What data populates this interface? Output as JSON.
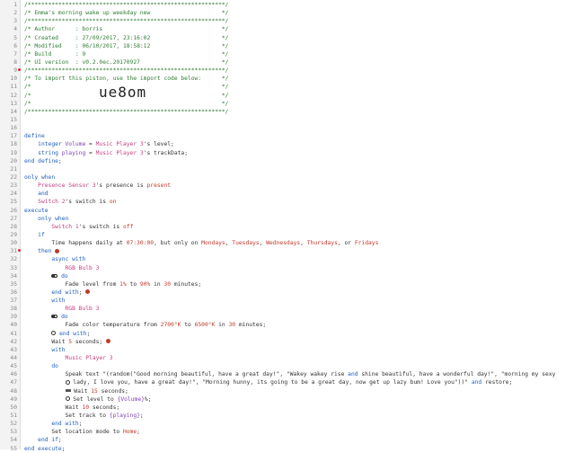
{
  "editor": {
    "lines": [
      "/**********************************************************/",
      "/* Emma's morning wake up weekday new                     */",
      "/**********************************************************/",
      "/* Author      : borris                                   */",
      "/* Created     : 27/09/2017, 23:16:02                     */",
      "/* Modified    : 06/10/2017, 18:58:12                     */",
      "/* Build       : 9                                        */",
      "/* UI version  : v0.2.0ec.20170927                        */",
      "/**********************************************************/",
      "/* To import this piston, use the import code below:      */",
      "/*                                                        */",
      "/*                                                        */",
      "/*                                                        */",
      "/**********************************************************/",
      "",
      "",
      "define",
      "    integer Volume = Music Player 3's level;",
      "    string playing = Music Player 3's trackData;",
      "end define;",
      "",
      "only when",
      "    Presence Sensor 3's presence is present",
      "    and",
      "    Switch 2's switch is on",
      "execute",
      "    only when",
      "        Switch 1's switch is off",
      "    if",
      "        Time happens daily at 07:30:00, but only on Mondays, Tuesdays, Wednesdays, Thursdays, or Fridays",
      "    then",
      "        async with",
      "            RGB Bulb 3",
      "        do",
      "            Fade level from 1% to 90% in 30 minutes;",
      "        end with;",
      "        with",
      "            RGB Bulb 3",
      "        do",
      "            Fade color temperature from 2700°K to 6500°K in 30 minutes;",
      "        end with;",
      "        Wait 5 seconds;",
      "        with",
      "            Music Player 3",
      "        do",
      "            Speak text \"(random(\"Good morning beautiful, have a great day!\", \"Wakey wakey rise and shine beautiful, have a wonderful day!\", \"morning my sexy",
      "            lady, I love you, have a great day!\", \"Morning hunny, its going to be a great day, now get up lazy bum! Love you\"))\" and restore;",
      "            Wait 15 seconds;",
      "            Set level to {Volume}%;",
      "            Wait 10 seconds;",
      "            Set track to {playing};",
      "        end with;",
      "        Set location mode to Home;",
      "    end if;",
      "end execute;"
    ],
    "import_code": "ue8om"
  }
}
